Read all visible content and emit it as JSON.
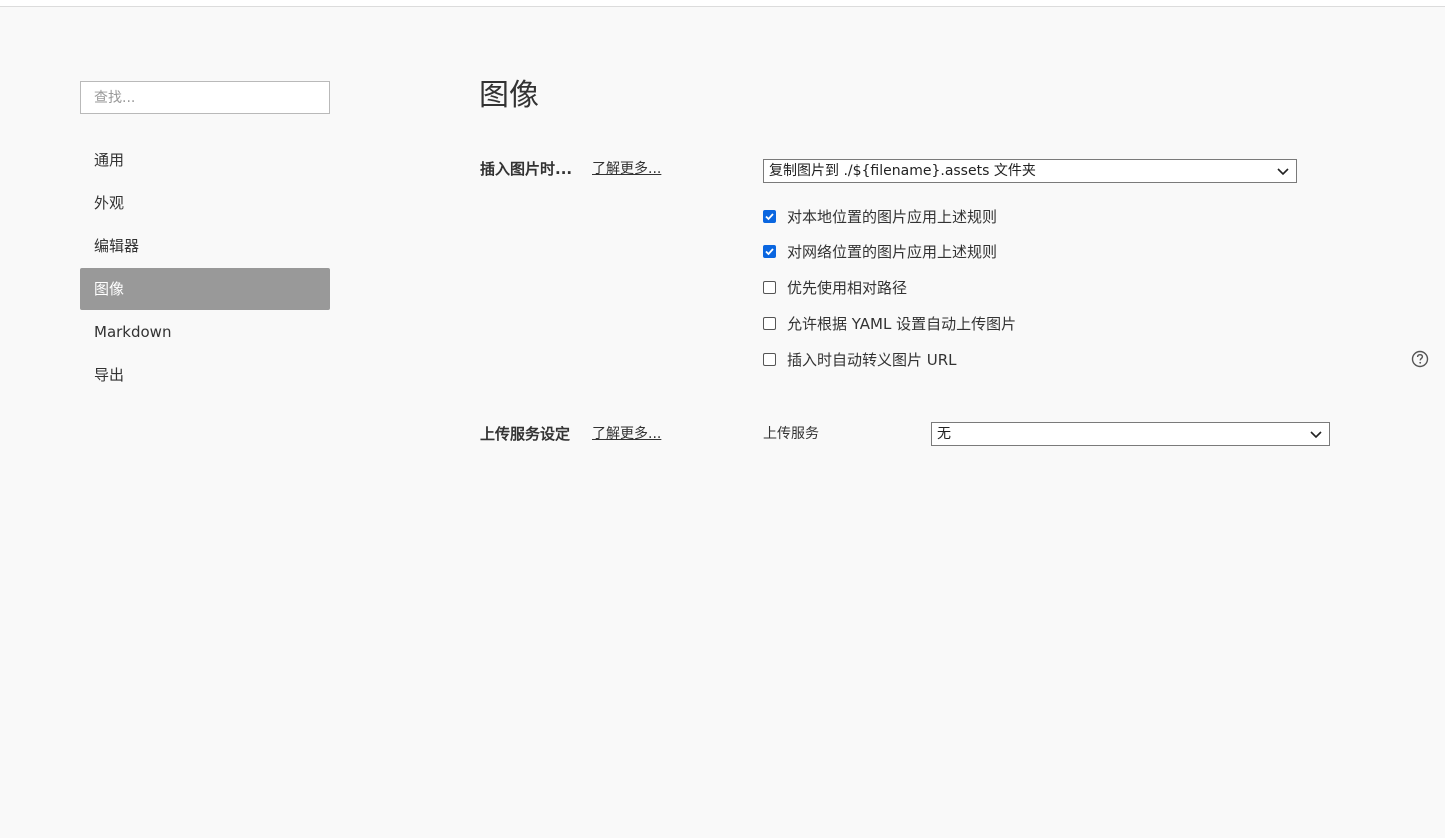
{
  "sidebar": {
    "search_placeholder": "查找...",
    "items": [
      {
        "label": "通用",
        "active": false
      },
      {
        "label": "外观",
        "active": false
      },
      {
        "label": "编辑器",
        "active": false
      },
      {
        "label": "图像",
        "active": true
      },
      {
        "label": "Markdown",
        "active": false
      },
      {
        "label": "导出",
        "active": false
      }
    ]
  },
  "main": {
    "title": "图像",
    "insert_image": {
      "label": "插入图片时...",
      "learn_more": "了解更多...",
      "selected_option": "复制图片到 ./${filename}.assets 文件夹",
      "options": [
        {
          "label": "对本地位置的图片应用上述规则",
          "checked": true
        },
        {
          "label": "对网络位置的图片应用上述规则",
          "checked": true
        },
        {
          "label": "优先使用相对路径",
          "checked": false
        },
        {
          "label": "允许根据 YAML 设置自动上传图片",
          "checked": false
        },
        {
          "label": "插入时自动转义图片 URL",
          "checked": false
        }
      ]
    },
    "upload": {
      "label": "上传服务设定",
      "learn_more": "了解更多...",
      "service_label": "上传服务",
      "selected_service": "无"
    }
  },
  "colors": {
    "background": "#f9f9f9",
    "active_nav": "#999999",
    "checkbox_checked": "#0a66e0"
  },
  "icons": {
    "dropdown": "chevron-down-icon",
    "help": "help-circle-icon",
    "check": "check-icon"
  }
}
